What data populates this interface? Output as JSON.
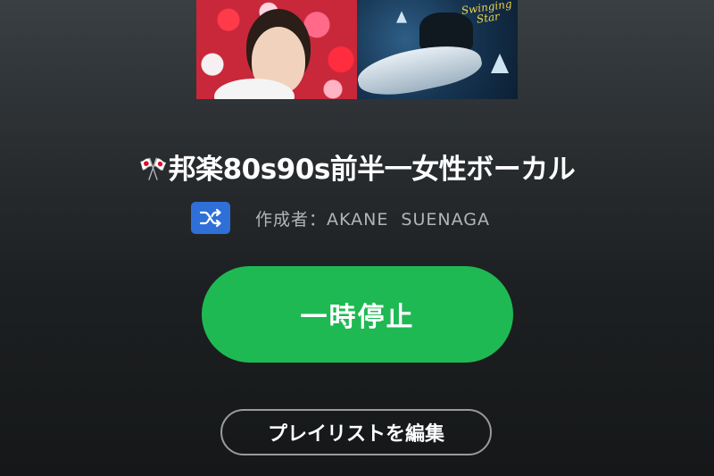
{
  "playlist": {
    "flag_emoji": "🎌",
    "title": "邦楽80s90s前半一女性ボーカル",
    "author_line": "作成者：AKANE  SUENAGA",
    "cover_text": "Swinging Star",
    "shuffle_icon": "shuffle-icon"
  },
  "actions": {
    "pause_label": "一時停止",
    "edit_label": "プレイリストを編集"
  },
  "colors": {
    "accent_green": "#1fb954",
    "shuffle_blue": "#2e6fd8"
  }
}
